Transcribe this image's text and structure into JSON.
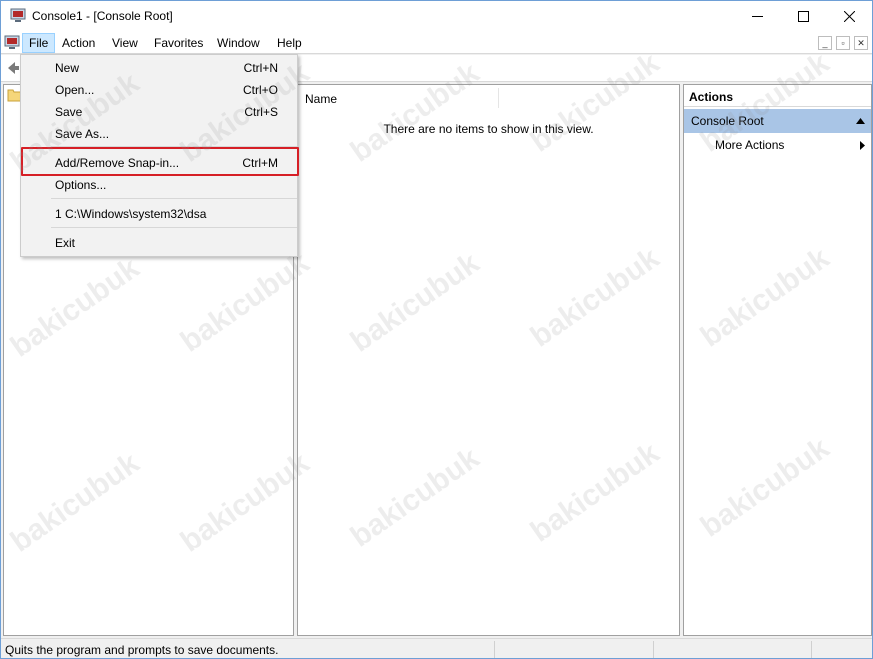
{
  "window": {
    "title": "Console1 - [Console Root]",
    "minimize_glyph": "—",
    "maximize_glyph": "☐",
    "close_glyph": "✕"
  },
  "menubar": {
    "items": [
      {
        "label": "File",
        "active": true
      },
      {
        "label": "Action"
      },
      {
        "label": "View"
      },
      {
        "label": "Favorites"
      },
      {
        "label": "Window"
      },
      {
        "label": "Help"
      }
    ],
    "mdi_buttons": [
      "_",
      "▫",
      "✕"
    ]
  },
  "file_menu": {
    "items": [
      {
        "label": "New",
        "shortcut": "Ctrl+N"
      },
      {
        "label": "Open...",
        "shortcut": "Ctrl+O"
      },
      {
        "label": "Save",
        "shortcut": "Ctrl+S"
      },
      {
        "label": "Save As...",
        "shortcut": ""
      },
      {
        "label": "Add/Remove Snap-in...",
        "shortcut": "Ctrl+M",
        "highlighted": true
      },
      {
        "label": "Options...",
        "shortcut": ""
      },
      {
        "label": "1 C:\\Windows\\system32\\dsa",
        "shortcut": ""
      },
      {
        "label": "Exit",
        "shortcut": ""
      }
    ],
    "highlight_color": "#d61f26"
  },
  "list_pane": {
    "column_name": "Name",
    "empty_message": "There are no items to show in this view."
  },
  "actions_pane": {
    "header": "Actions",
    "section_label": "Console Root",
    "more_actions_label": "More Actions"
  },
  "statusbar": {
    "text": "Quits the program and prompts to save documents."
  },
  "watermark": {
    "text": "bakicubuk"
  },
  "colors": {
    "section_bg": "#a9c5e6",
    "menu_active_bg": "#cce8ff",
    "window_border": "#6e9fd6"
  },
  "icons": {
    "app": "mmc-console-icon",
    "back": "back-arrow-icon",
    "tree_root": "folder-icon"
  }
}
